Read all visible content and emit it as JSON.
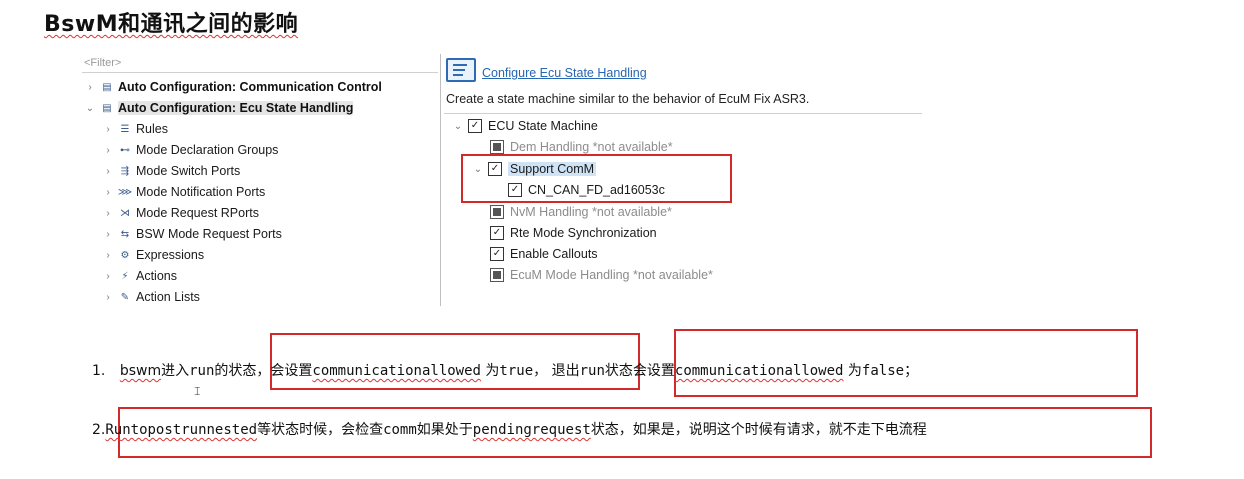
{
  "page": {
    "title": "BswM和通讯之间的影响"
  },
  "tree": {
    "filter_placeholder": "<Filter>",
    "nodes": [
      {
        "label": "Auto Configuration: Communication Control",
        "expander": "›",
        "icon": "▤"
      },
      {
        "label": "Auto Configuration: Ecu State Handling",
        "expander": "⌄",
        "icon": "▤"
      },
      {
        "label": "Rules",
        "expander": "›",
        "icon": "☰"
      },
      {
        "label": "Mode Declaration Groups",
        "expander": "›",
        "icon": "⊷"
      },
      {
        "label": "Mode Switch Ports",
        "expander": "›",
        "icon": "⇶"
      },
      {
        "label": "Mode Notification Ports",
        "expander": "›",
        "icon": "⋙"
      },
      {
        "label": "Mode Request RPorts",
        "expander": "›",
        "icon": "⋊"
      },
      {
        "label": "BSW Mode Request Ports",
        "expander": "›",
        "icon": "⇆"
      },
      {
        "label": "Expressions",
        "expander": "›",
        "icon": "⚙"
      },
      {
        "label": "Actions",
        "expander": "›",
        "icon": "⚡"
      },
      {
        "label": "Action Lists",
        "expander": "›",
        "icon": "✎"
      }
    ]
  },
  "panel": {
    "title": "Configure Ecu State Handling",
    "description": "Create a state machine similar to the behavior of EcuM Fix ASR3.",
    "items": [
      {
        "label": "ECU State Machine",
        "state": "checked",
        "expander": "⌄"
      },
      {
        "label": "Dem Handling *not available*",
        "state": "disabled"
      },
      {
        "label": "Support ComM",
        "state": "checked",
        "expander": "⌄"
      },
      {
        "label": "CN_CAN_FD_ad16053c",
        "state": "checked"
      },
      {
        "label": "NvM Handling *not available*",
        "state": "disabled"
      },
      {
        "label": "Rte Mode Synchronization",
        "state": "checked"
      },
      {
        "label": "Enable Callouts",
        "state": "checked"
      },
      {
        "label": "EcuM Mode Handling *not available*",
        "state": "disabled"
      }
    ]
  },
  "notes": {
    "n1_num": "1.",
    "n1_a": "bswm",
    "n1_b": "进入",
    "n1_c": "run",
    "n1_d": "的状态，",
    "n1_e": "会设置",
    "n1_f": "communicationallowed",
    "n1_g": " 为",
    "n1_h": "true",
    "n1_i": "，  退出",
    "n1_j": "run",
    "n1_k": "状态会设置",
    "n1_l": "communicationallowed",
    "n1_m": " 为",
    "n1_n": "false",
    "n1_o": "；",
    "n2_num": "2.",
    "n2_a": "Runtopostrunnested",
    "n2_b": "等状态时候，会检查",
    "n2_c": "comm",
    "n2_d": "如果处于",
    "n2_e": "pendingrequest",
    "n2_f": "状态，如果是，说明这个时候有请求，就不走下电流程"
  },
  "colors": {
    "annotation_red": "#d12a2a",
    "link_blue": "#2766b0",
    "selection": "#cfe3f7"
  }
}
